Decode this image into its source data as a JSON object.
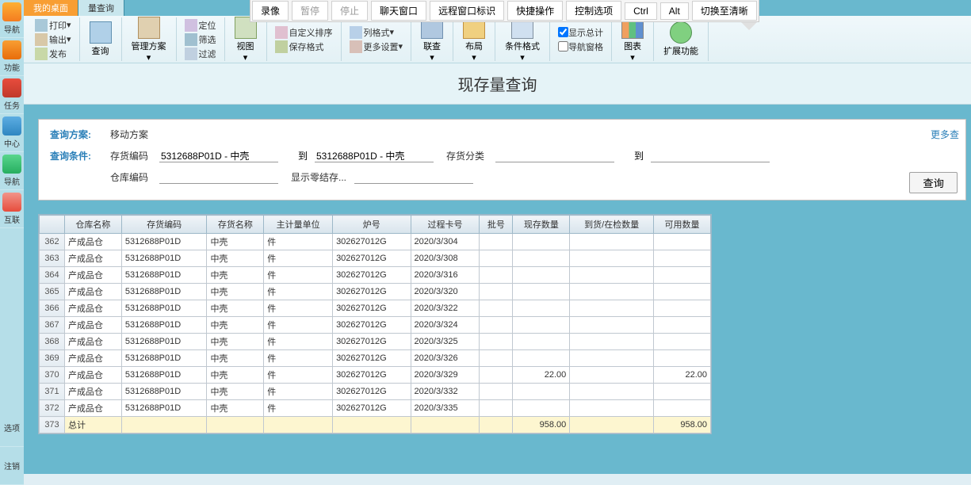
{
  "remote_bar": {
    "record": "录像",
    "pause": "暂停",
    "stop": "停止",
    "chat": "聊天窗口",
    "remote_id": "远程窗口标识",
    "quick": "快捷操作",
    "control": "控制选项",
    "ctrl": "Ctrl",
    "alt": "Alt",
    "switch": "切换至清晰"
  },
  "tabs": {
    "t1": "我的桌面",
    "t2": "量查询"
  },
  "sidebar": {
    "nav": "导航",
    "func": "功能",
    "task": "任务",
    "center": "中心",
    "nav2": "导航",
    "connect": "互联",
    "option": "选项",
    "logout": "注销"
  },
  "ribbon": {
    "print": "打印",
    "export": "输出",
    "publish": "发布",
    "query": "查询",
    "manage": "管理方案",
    "locate": "定位",
    "filter2": "筛选",
    "filter": "过滤",
    "view": "视图",
    "custom_sort": "自定义排序",
    "save_fmt": "保存格式",
    "col_fmt": "列格式",
    "more_set": "更多设置",
    "link_query": "联查",
    "layout": "布局",
    "cond_fmt": "条件格式",
    "show_total": "显示总计",
    "nav_pane": "导航窗格",
    "chart": "图表",
    "extend": "扩展功能"
  },
  "title": "现存量查询",
  "query": {
    "scheme_label": "查询方案:",
    "scheme_value": "移动方案",
    "more": "更多查",
    "cond_label": "查询条件:",
    "stock_code_label": "存货编码",
    "stock_code_from": "5312688P01D - 中壳",
    "to_label": "到",
    "stock_code_to": "5312688P01D - 中壳",
    "stock_class_label": "存货分类",
    "stock_class_value": "",
    "to2_label": "到",
    "to2_value": "",
    "warehouse_label": "仓库编码",
    "warehouse_value": "",
    "show_zero_label": "显示零结存...",
    "show_zero_value": "",
    "query_btn": "查询"
  },
  "table": {
    "headers": {
      "wh": "仓库名称",
      "code": "存货编码",
      "name": "存货名称",
      "unit": "主计量单位",
      "furnace": "炉号",
      "process": "过程卡号",
      "batch": "批号",
      "stock": "现存数量",
      "arrive": "到货/在检数量",
      "avail": "可用数量"
    },
    "rows": [
      {
        "n": "362",
        "wh": "产成品仓",
        "code": "5312688P01D",
        "name": "中壳",
        "unit": "件",
        "furnace": "302627012G",
        "process": "2020/3/304",
        "batch": "",
        "stock": "",
        "arrive": "",
        "avail": ""
      },
      {
        "n": "363",
        "wh": "产成品仓",
        "code": "5312688P01D",
        "name": "中壳",
        "unit": "件",
        "furnace": "302627012G",
        "process": "2020/3/308",
        "batch": "",
        "stock": "",
        "arrive": "",
        "avail": ""
      },
      {
        "n": "364",
        "wh": "产成品仓",
        "code": "5312688P01D",
        "name": "中壳",
        "unit": "件",
        "furnace": "302627012G",
        "process": "2020/3/316",
        "batch": "",
        "stock": "",
        "arrive": "",
        "avail": ""
      },
      {
        "n": "365",
        "wh": "产成品仓",
        "code": "5312688P01D",
        "name": "中壳",
        "unit": "件",
        "furnace": "302627012G",
        "process": "2020/3/320",
        "batch": "",
        "stock": "",
        "arrive": "",
        "avail": ""
      },
      {
        "n": "366",
        "wh": "产成品仓",
        "code": "5312688P01D",
        "name": "中壳",
        "unit": "件",
        "furnace": "302627012G",
        "process": "2020/3/322",
        "batch": "",
        "stock": "",
        "arrive": "",
        "avail": ""
      },
      {
        "n": "367",
        "wh": "产成品仓",
        "code": "5312688P01D",
        "name": "中壳",
        "unit": "件",
        "furnace": "302627012G",
        "process": "2020/3/324",
        "batch": "",
        "stock": "",
        "arrive": "",
        "avail": ""
      },
      {
        "n": "368",
        "wh": "产成品仓",
        "code": "5312688P01D",
        "name": "中壳",
        "unit": "件",
        "furnace": "302627012G",
        "process": "2020/3/325",
        "batch": "",
        "stock": "",
        "arrive": "",
        "avail": ""
      },
      {
        "n": "369",
        "wh": "产成品仓",
        "code": "5312688P01D",
        "name": "中壳",
        "unit": "件",
        "furnace": "302627012G",
        "process": "2020/3/326",
        "batch": "",
        "stock": "",
        "arrive": "",
        "avail": ""
      },
      {
        "n": "370",
        "wh": "产成品仓",
        "code": "5312688P01D",
        "name": "中壳",
        "unit": "件",
        "furnace": "302627012G",
        "process": "2020/3/329",
        "batch": "",
        "stock": "22.00",
        "arrive": "",
        "avail": "22.00"
      },
      {
        "n": "371",
        "wh": "产成品仓",
        "code": "5312688P01D",
        "name": "中壳",
        "unit": "件",
        "furnace": "302627012G",
        "process": "2020/3/332",
        "batch": "",
        "stock": "",
        "arrive": "",
        "avail": ""
      },
      {
        "n": "372",
        "wh": "产成品仓",
        "code": "5312688P01D",
        "name": "中壳",
        "unit": "件",
        "furnace": "302627012G",
        "process": "2020/3/335",
        "batch": "",
        "stock": "",
        "arrive": "",
        "avail": ""
      }
    ],
    "total": {
      "n": "373",
      "label": "总计",
      "stock": "958.00",
      "avail": "958.00"
    }
  }
}
